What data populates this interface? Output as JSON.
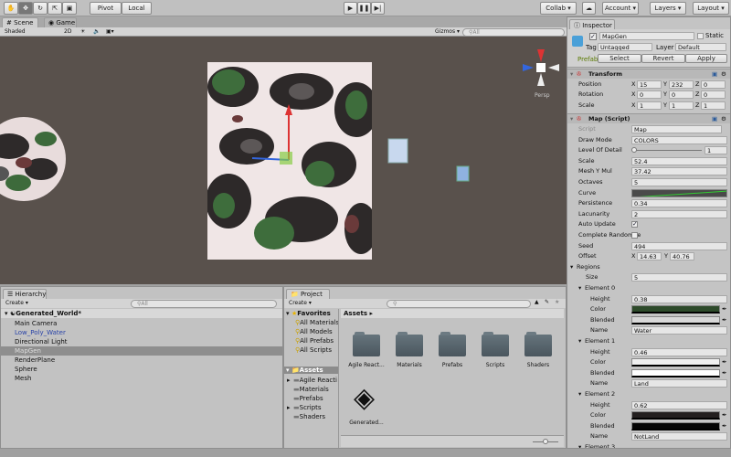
{
  "toolbar": {
    "tools": [
      "hand-icon",
      "move-icon",
      "rotate-icon",
      "scale-icon",
      "rect-icon"
    ],
    "pivot_label": "Pivot",
    "local_label": "Local",
    "collab_label": "Collab",
    "account_label": "Account",
    "layers_label": "Layers",
    "layout_label": "Layout"
  },
  "scene": {
    "tabs": [
      {
        "label": "Scene",
        "active": true
      },
      {
        "label": "Game",
        "active": false
      }
    ],
    "shading": "Shaded",
    "mode_2d": "2D",
    "gizmos_label": "Gizmos",
    "search_placeholder": "All",
    "persp_label": "Persp",
    "bg_color": "#59514c"
  },
  "hierarchy": {
    "title": "Hierarchy",
    "create_label": "Create",
    "search_placeholder": "All",
    "scene_name": "Generated_World*",
    "items": [
      {
        "label": "Main Camera",
        "state": "normal"
      },
      {
        "label": "Low_Poly_Water",
        "state": "prefab"
      },
      {
        "label": "Directional Light",
        "state": "normal"
      },
      {
        "label": "MapGen",
        "state": "selected"
      },
      {
        "label": "RenderPlane",
        "state": "normal"
      },
      {
        "label": "Sphere",
        "state": "normal"
      },
      {
        "label": "Mesh",
        "state": "normal"
      }
    ]
  },
  "project": {
    "title": "Project",
    "create_label": "Create",
    "favorites_label": "Favorites",
    "favorites": [
      "All Materials",
      "All Models",
      "All Prefabs",
      "All Scripts"
    ],
    "assets_label": "Assets",
    "tree": [
      {
        "label": "Agile Reacti",
        "expandable": true
      },
      {
        "label": "Materials",
        "expandable": false
      },
      {
        "label": "Prefabs",
        "expandable": false
      },
      {
        "label": "Scripts",
        "expandable": true
      },
      {
        "label": "Shaders",
        "expandable": false
      }
    ],
    "breadcrumb": "Assets",
    "folders": [
      "Agile React...",
      "Materials",
      "Prefabs",
      "Scripts",
      "Shaders"
    ],
    "scene_asset": "Generated..."
  },
  "inspector": {
    "title": "Inspector",
    "object_name": "MapGen",
    "active": true,
    "static_label": "Static",
    "tag_label": "Tag",
    "tag_value": "Untagged",
    "layer_label": "Layer",
    "layer_value": "Default",
    "prefab_label": "Prefab",
    "prefab_buttons": [
      "Select",
      "Revert",
      "Apply"
    ],
    "transform": {
      "title": "Transform",
      "position": {
        "label": "Position",
        "x": "15",
        "y": "232",
        "z": "0"
      },
      "rotation": {
        "label": "Rotation",
        "x": "0",
        "y": "0",
        "z": "0"
      },
      "scale": {
        "label": "Scale",
        "x": "1",
        "y": "1",
        "z": "1"
      }
    },
    "script_component": {
      "title": "Map (Script)",
      "fields": [
        {
          "label": "Script",
          "value": "Map",
          "type": "disabled"
        },
        {
          "label": "Draw Mode",
          "value": "COLORS",
          "type": "dropdown"
        },
        {
          "label": "Level Of Detail",
          "value": "1",
          "type": "slider",
          "slider_fraction": 0
        },
        {
          "label": "Scale",
          "value": "52.4",
          "type": "text"
        },
        {
          "label": "Mesh Y Mul",
          "value": "37.42",
          "type": "text"
        },
        {
          "label": "Octaves",
          "value": "5",
          "type": "text"
        },
        {
          "label": "Curve",
          "value": "",
          "type": "curve"
        },
        {
          "label": "Persistence",
          "value": "0.34",
          "type": "text"
        },
        {
          "label": "Lacunarity",
          "value": "2",
          "type": "text"
        },
        {
          "label": "Auto Update",
          "value": true,
          "type": "checkbox"
        },
        {
          "label": "Complete Randomne",
          "value": false,
          "type": "checkbox"
        },
        {
          "label": "Seed",
          "value": "494",
          "type": "text"
        },
        {
          "label": "Offset",
          "x": "14.63",
          "y": "40.76",
          "type": "vec2"
        }
      ],
      "regions": {
        "label": "Regions",
        "size_label": "Size",
        "size": "5",
        "elements": [
          {
            "label": "Element 0",
            "height": "0.38",
            "color": "#2d4a2a",
            "blended": "#d8d8d8",
            "name": "Water"
          },
          {
            "label": "Element 1",
            "height": "0.46",
            "color": "#f0f0f0",
            "blended": "#ffffff",
            "name": "Land"
          },
          {
            "label": "Element 2",
            "height": "0.62",
            "color": "#231f1f",
            "blended": "#050505",
            "name": "NotLand"
          },
          {
            "label": "Element 3"
          }
        ],
        "height_label": "Height",
        "color_label": "Color",
        "blended_label": "Blended",
        "name_label": "Name"
      }
    }
  }
}
